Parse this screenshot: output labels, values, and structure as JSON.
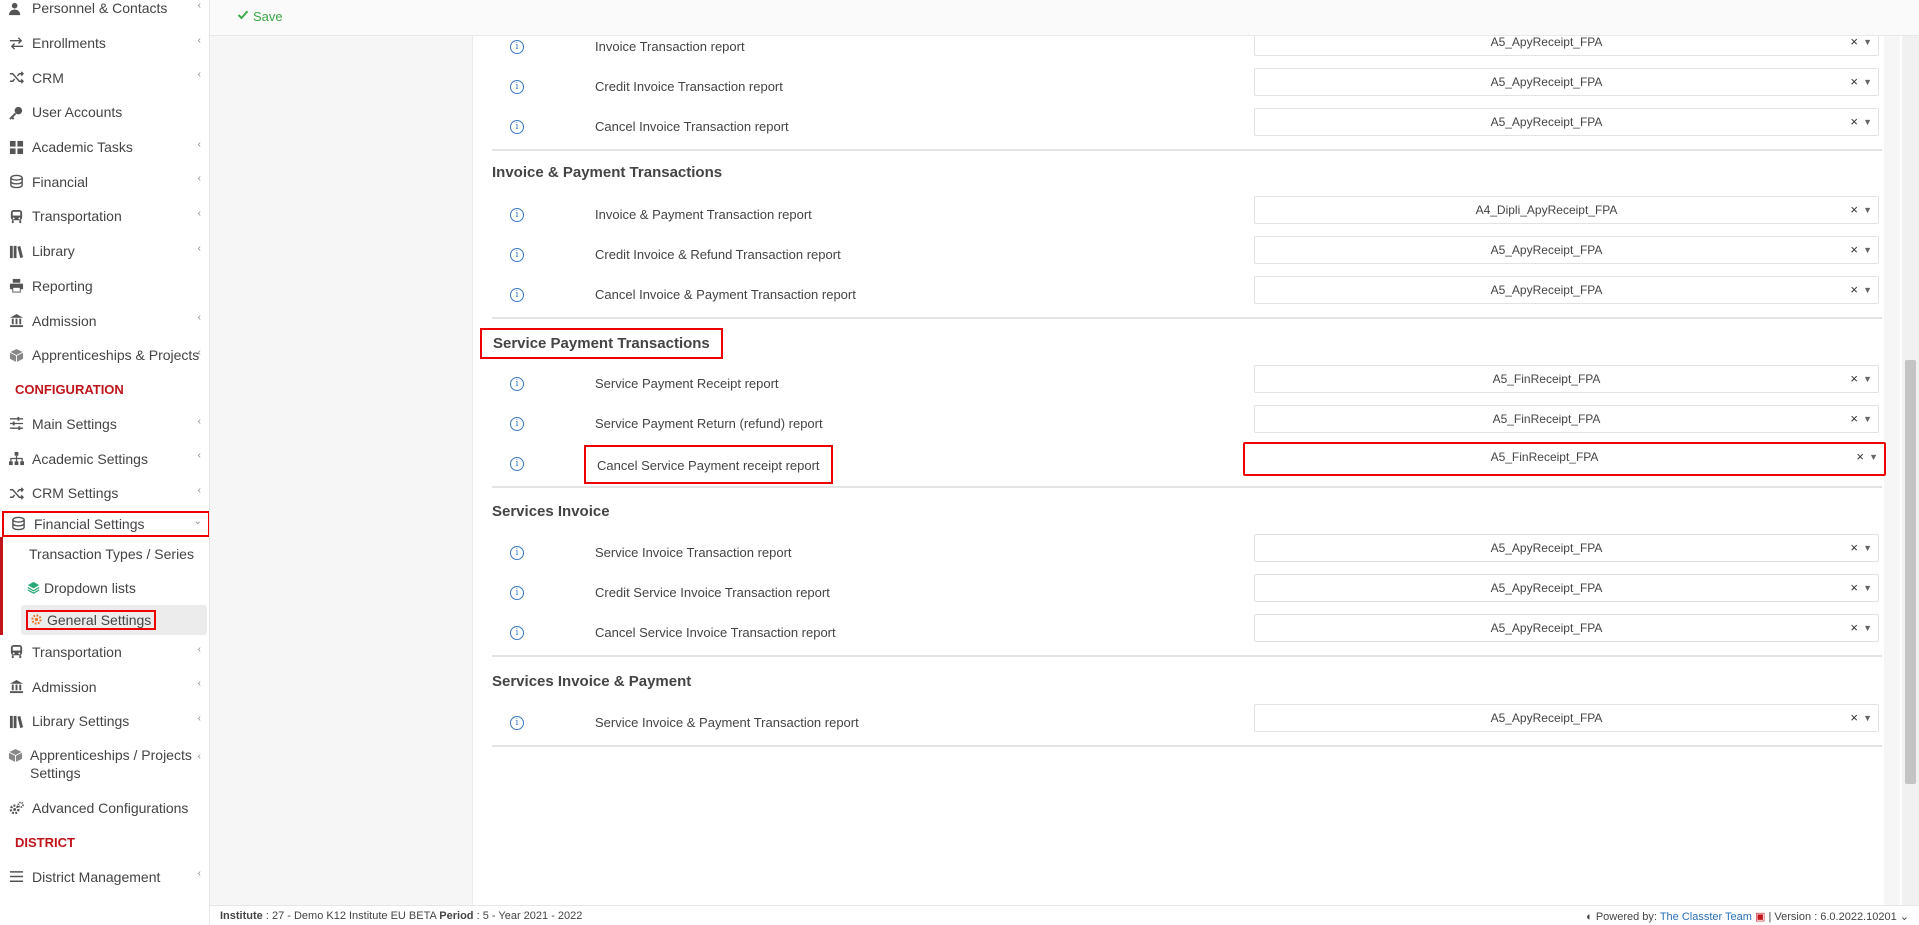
{
  "toolbar": {
    "save_label": "Save"
  },
  "sidebar": {
    "main_items": [
      {
        "label": "Personnel & Contacts",
        "icon": "user-contacts-icon",
        "chevron": true
      },
      {
        "label": "Enrollments",
        "icon": "exchange-icon",
        "chevron": true
      },
      {
        "label": "CRM",
        "icon": "shuffle-icon",
        "chevron": true
      },
      {
        "label": "User Accounts",
        "icon": "key-icon",
        "chevron": false
      },
      {
        "label": "Academic Tasks",
        "icon": "grid-icon",
        "chevron": true
      },
      {
        "label": "Financial",
        "icon": "coins-icon",
        "chevron": true
      },
      {
        "label": "Transportation",
        "icon": "bus-icon",
        "chevron": true
      },
      {
        "label": "Library",
        "icon": "books-icon",
        "chevron": true
      },
      {
        "label": "Reporting",
        "icon": "printer-icon",
        "chevron": false
      },
      {
        "label": "Admission",
        "icon": "institution-icon",
        "chevron": true
      },
      {
        "label": "Apprenticeships & Projects",
        "icon": "cube-icon",
        "chevron": true
      }
    ],
    "configuration_heading": "CONFIGURATION",
    "config_items": [
      {
        "label": "Main Settings",
        "icon": "sliders-icon",
        "chevron": true
      },
      {
        "label": "Academic Settings",
        "icon": "sitemap-icon",
        "chevron": true
      },
      {
        "label": "CRM Settings",
        "icon": "shuffle-icon",
        "chevron": true
      }
    ],
    "financial_settings": {
      "label": "Financial Settings",
      "icon": "coins-icon",
      "subitems": [
        {
          "label": "Transaction Types / Series",
          "icon": ""
        },
        {
          "label": "Dropdown lists",
          "icon": "layers-icon"
        },
        {
          "label": "General Settings",
          "icon": "cog-icon"
        }
      ]
    },
    "config_items_after": [
      {
        "label": "Transportation",
        "icon": "bus-icon",
        "chevron": true
      },
      {
        "label": "Admission",
        "icon": "institution-icon",
        "chevron": true
      },
      {
        "label": "Library Settings",
        "icon": "books-icon",
        "chevron": true
      },
      {
        "label": "Apprenticeships / Projects Settings",
        "icon": "cube-icon",
        "chevron": true
      },
      {
        "label": "Advanced Configurations",
        "icon": "cogs-icon",
        "chevron": false
      }
    ],
    "district_heading": "DISTRICT",
    "district_items": [
      {
        "label": "District Management",
        "icon": "list-icon",
        "chevron": true
      }
    ]
  },
  "sections": [
    {
      "title": "",
      "rows": [
        {
          "label": "Invoice Transaction report",
          "value": "A5_ApyReceipt_FPA"
        },
        {
          "label": "Credit Invoice Transaction report",
          "value": "A5_ApyReceipt_FPA"
        },
        {
          "label": "Cancel Invoice Transaction report",
          "value": "A5_ApyReceipt_FPA"
        }
      ]
    },
    {
      "title": "Invoice & Payment Transactions",
      "rows": [
        {
          "label": "Invoice & Payment Transaction report",
          "value": "A4_Dipli_ApyReceipt_FPA"
        },
        {
          "label": "Credit Invoice & Refund Transaction report",
          "value": "A5_ApyReceipt_FPA"
        },
        {
          "label": "Cancel Invoice & Payment Transaction report",
          "value": "A5_ApyReceipt_FPA"
        }
      ]
    },
    {
      "title": "Service Payment Transactions",
      "rows": [
        {
          "label": "Service Payment Receipt report",
          "value": "A5_FinReceipt_FPA"
        },
        {
          "label": "Service Payment Return (refund) report",
          "value": "A5_FinReceipt_FPA"
        },
        {
          "label": "Cancel Service Payment receipt report",
          "value": "A5_FinReceipt_FPA"
        }
      ]
    },
    {
      "title": "Services Invoice",
      "rows": [
        {
          "label": "Service Invoice Transaction report",
          "value": "A5_ApyReceipt_FPA"
        },
        {
          "label": "Credit Service Invoice Transaction report",
          "value": "A5_ApyReceipt_FPA"
        },
        {
          "label": "Cancel Service Invoice Transaction report",
          "value": "A5_ApyReceipt_FPA"
        }
      ]
    },
    {
      "title": "Services Invoice & Payment",
      "rows": [
        {
          "label": "Service Invoice & Payment Transaction report",
          "value": "A5_ApyReceipt_FPA"
        }
      ]
    }
  ],
  "footer": {
    "institute_label": "Institute",
    "institute_value": ": 27 - Demo K12 Institute EU BETA",
    "period_label": "Period",
    "period_value": ": 5 - Year 2021 - 2022",
    "powered_by": "Powered by:",
    "team": "The Classter Team",
    "version": "| Version : 6.0.2022.10201"
  },
  "colors": {
    "accent_red": "#c0141b",
    "highlight_box": "#ee0000",
    "save_green": "#39a846",
    "link_blue": "#2a6fb5"
  }
}
